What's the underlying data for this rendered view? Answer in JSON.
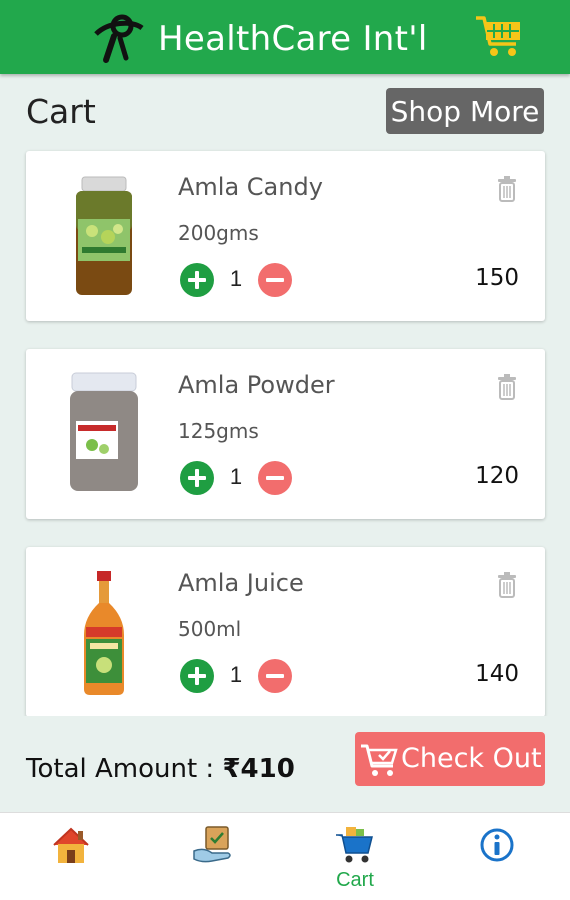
{
  "app": {
    "title": "HealthCare Int'l",
    "brand_color": "#22a84c"
  },
  "page": {
    "title": "Cart",
    "shop_more_label": "Shop More"
  },
  "cart_items": [
    {
      "name": "Amla Candy",
      "size": "200gms",
      "quantity": "1",
      "price": "150",
      "image_icon": "candy-jar"
    },
    {
      "name": "Amla Powder",
      "size": "125gms",
      "quantity": "1",
      "price": "120",
      "image_icon": "powder-jar"
    },
    {
      "name": "Amla Juice",
      "size": "500ml",
      "quantity": "1",
      "price": "140",
      "image_icon": "juice-bottle"
    }
  ],
  "summary": {
    "total_label": "Total Amount : ",
    "total_value": "₹410",
    "checkout_label": "Check Out"
  },
  "bottom_nav": {
    "items": [
      {
        "label": "",
        "icon": "home-icon"
      },
      {
        "label": "",
        "icon": "offers-icon"
      },
      {
        "label": "Cart",
        "icon": "cart-icon",
        "active": true
      },
      {
        "label": "",
        "icon": "info-icon"
      }
    ]
  },
  "colors": {
    "accent": "#22a84c",
    "checkout": "#f26d6d",
    "shop_more": "#666666",
    "info": "#1a73c9"
  }
}
